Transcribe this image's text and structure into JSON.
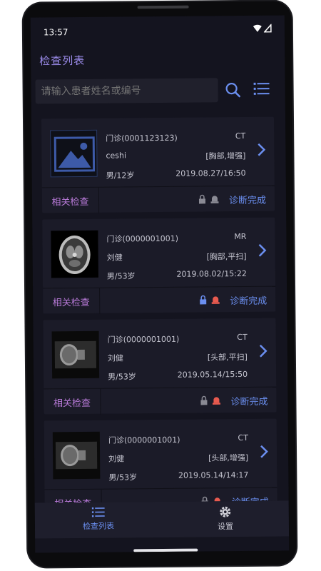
{
  "status": {
    "time": "13:57"
  },
  "header": {
    "title": "检查列表"
  },
  "search": {
    "placeholder": "请输入患者姓名或编号"
  },
  "cards": [
    {
      "visit": "门诊(0001123123)",
      "modality": "CT",
      "name": "ceshi",
      "body_part": "[胸部,增强]",
      "sex_age": "男/12岁",
      "date": "2019.08.27/16:50",
      "related_label": "相关检查",
      "status": "诊断完成",
      "lock_color": "#8a8a94",
      "alarm_color": "#8a8a94",
      "thumb": "placeholder-image-icon"
    },
    {
      "visit": "门诊(0000001001)",
      "modality": "MR",
      "name": "刘健",
      "body_part": "[胸部,平扫]",
      "sex_age": "男/53岁",
      "date": "2019.08.02/15:22",
      "related_label": "相关检查",
      "status": "诊断完成",
      "lock_color": "#6b8ff0",
      "alarm_color": "#e85a4f",
      "thumb": "brain-mr-image"
    },
    {
      "visit": "门诊(0000001001)",
      "modality": "CT",
      "name": "刘健",
      "body_part": "[头部,平扫]",
      "sex_age": "男/53岁",
      "date": "2019.05.14/15:50",
      "related_label": "相关检查",
      "status": "诊断完成",
      "lock_color": "#8a8a94",
      "alarm_color": "#e85a4f",
      "thumb": "head-ct-image"
    },
    {
      "visit": "门诊(0000001001)",
      "modality": "CT",
      "name": "刘健",
      "body_part": "[头部,增强]",
      "sex_age": "男/53岁",
      "date": "2019.05.14/14:17",
      "related_label": "相关检查",
      "status": "诊断完成",
      "lock_color": "#8a8a94",
      "alarm_color": "#e85a4f",
      "thumb": "head-ct-image"
    }
  ],
  "nav": {
    "list_label": "检查列表",
    "settings_label": "设置"
  },
  "colors": {
    "accent": "#6b8ff0",
    "title": "#9b8bea",
    "related": "#b87ad8",
    "background": "#14141f",
    "card": "#1b1b28"
  }
}
